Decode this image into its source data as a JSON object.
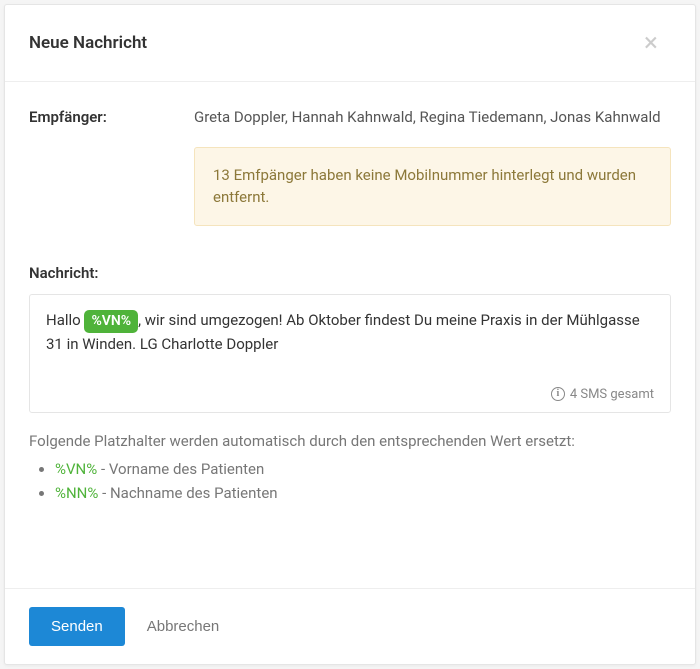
{
  "header": {
    "title": "Neue Nachricht"
  },
  "recipients": {
    "label": "Empfänger:",
    "names": "Greta Doppler, Hannah Kahnwald, Regina Tiedemann, Jonas Kahnwald",
    "warning": "13 Emfpänger haben keine Mobilnummer hinterlegt und wurden entfernt."
  },
  "message": {
    "label": "Nachricht:",
    "prefix": "Hallo ",
    "tag": "%VN%",
    "suffix": ", wir sind umgezogen! Ab Oktober findest Du meine Praxis in der Mühlgasse 31 in Winden. LG Charlotte Doppler",
    "sms_count": "4 SMS gesamt"
  },
  "placeholders": {
    "intro": "Folgende Platzhalter werden automatisch durch den entsprechenden Wert ersetzt:",
    "items": [
      {
        "code": "%VN%",
        "desc": " - Vorname des Patienten"
      },
      {
        "code": "%NN%",
        "desc": " - Nachname des Patienten"
      }
    ]
  },
  "footer": {
    "send": "Senden",
    "cancel": "Abbrechen"
  }
}
